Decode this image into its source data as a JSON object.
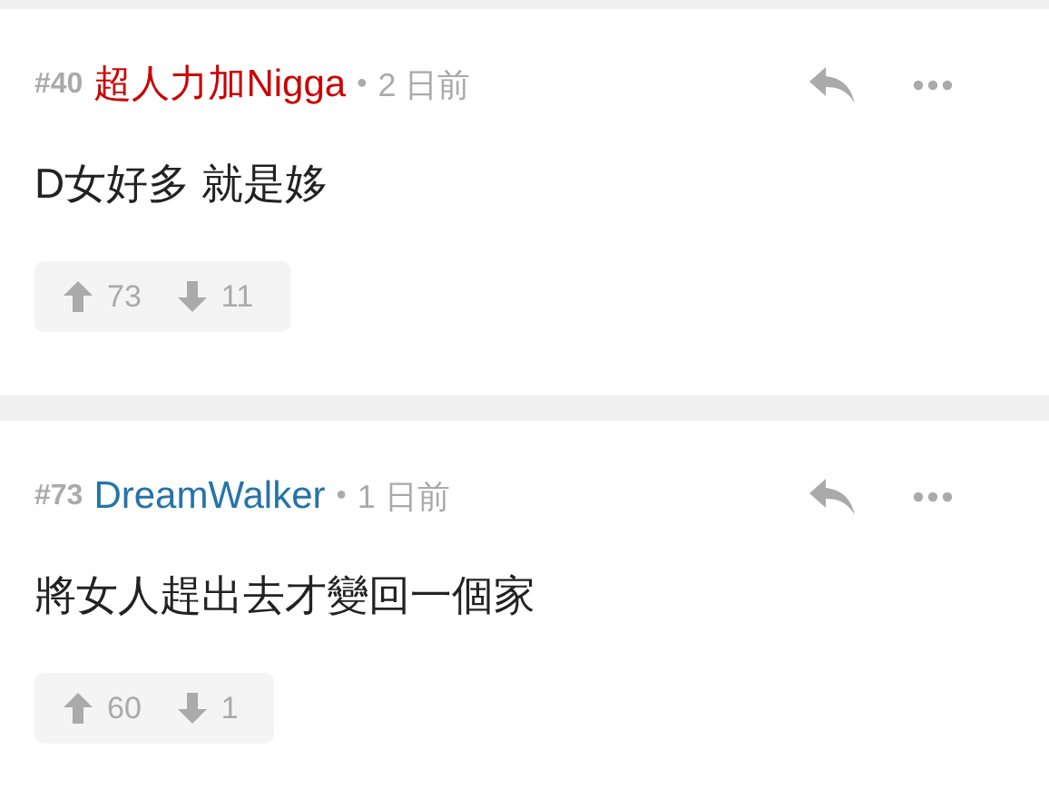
{
  "comments": [
    {
      "number": "#40",
      "username": "超人力加Nigga",
      "color": "#cc0000",
      "separator": "•",
      "time": "2 日前",
      "text": "D女好多 就是姼",
      "upvotes": "73",
      "downvotes": "11"
    },
    {
      "number": "#73",
      "username": "DreamWalker",
      "color": "#2574a9",
      "separator": "•",
      "time": "1 日前",
      "text": "將女人趕出去才變回一個家",
      "upvotes": "60",
      "downvotes": "1"
    }
  ]
}
